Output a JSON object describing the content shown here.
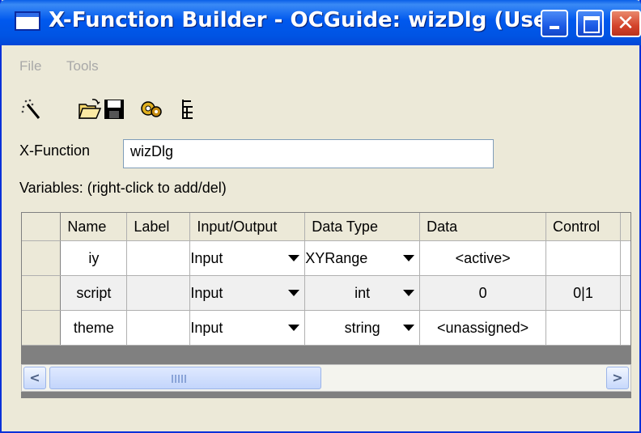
{
  "window": {
    "title": "X-Function Builder - OCGuide: wizDlg (User)"
  },
  "menu": {
    "file": "File",
    "tools": "Tools"
  },
  "toolbar": {
    "icons": [
      "wizard-icon",
      "open-folder-icon",
      "save-icon",
      "compile-icon",
      "tree-view-icon"
    ]
  },
  "form": {
    "xfunction_label": "X-Function",
    "xfunction_value": "wizDlg",
    "variables_label": "Variables: (right-click to add/del)"
  },
  "table": {
    "columns": [
      "Name",
      "Label",
      "Input/Output",
      "Data Type",
      "Data",
      "Control"
    ],
    "rows": [
      {
        "name": "iy",
        "label": "",
        "io": "Input",
        "type": "XYRange",
        "data": "<active>",
        "control": ""
      },
      {
        "name": "script",
        "label": "",
        "io": "Input",
        "type": "int",
        "data": "0",
        "control": "0|1"
      },
      {
        "name": "theme",
        "label": "",
        "io": "Input",
        "type": "string",
        "data": "<unassigned>",
        "control": ""
      }
    ]
  },
  "scrollbar": {
    "left_arrow": "<",
    "right_arrow": ">"
  },
  "colors": {
    "titlebar": "#0054e3",
    "window_bg": "#ece9d8",
    "close_button": "#d4432b"
  }
}
